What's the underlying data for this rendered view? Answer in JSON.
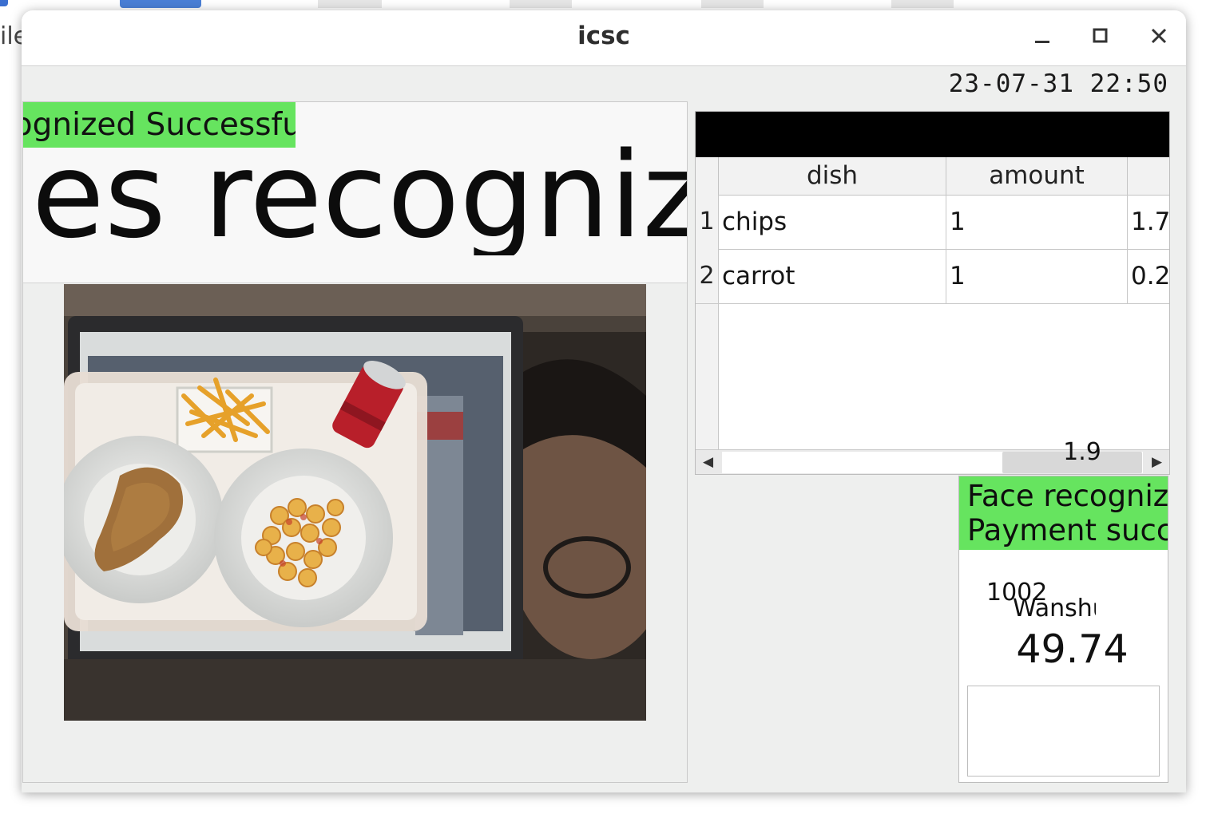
{
  "window": {
    "title": "icsc",
    "datetime": "23-07-31 22:50"
  },
  "background": {
    "left_text": "ile"
  },
  "recognition": {
    "status_label": "cognized Successfu",
    "big_label": "hes recogniz"
  },
  "table": {
    "headers": [
      "dish",
      "amount",
      ""
    ],
    "rows": [
      {
        "num": "1",
        "dish": "chips",
        "amount": "1",
        "price": "1.7"
      },
      {
        "num": "2",
        "dish": "carrot",
        "amount": "1",
        "price": "0.2"
      }
    ],
    "total": "1.9",
    "scroll_left_icon": "arrow-left-icon",
    "scroll_right_icon": "arrow-right-icon"
  },
  "payment": {
    "face_line1": "Face recogniz",
    "face_line2": "Payment succ",
    "user_id": "1002",
    "user_name": "Wanshu",
    "balance": "49.74"
  },
  "colors": {
    "success_green": "#66e45f",
    "table_title_bg": "#000000"
  }
}
